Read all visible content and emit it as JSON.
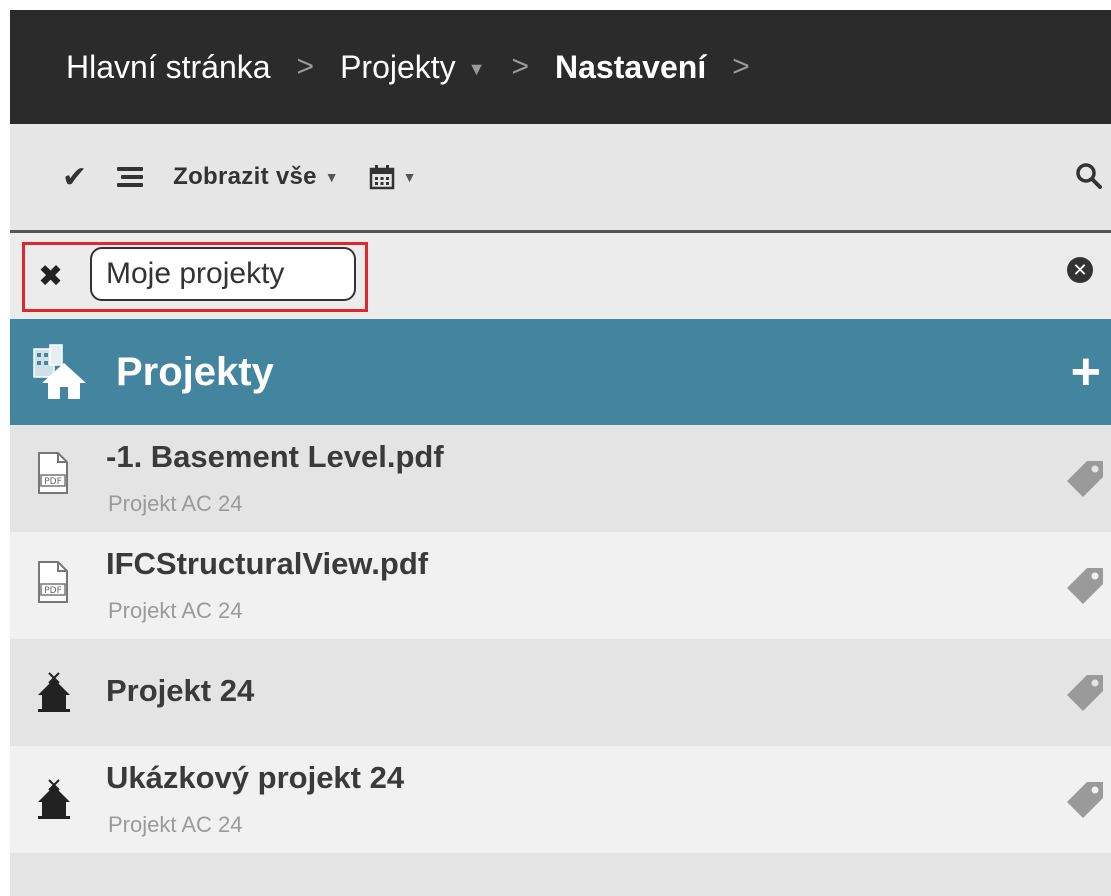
{
  "breadcrumb": {
    "items": [
      {
        "label": "Hlavní stránka"
      },
      {
        "label": "Projekty"
      },
      {
        "label": "Nastavení"
      }
    ],
    "separator": ">"
  },
  "toolbar": {
    "filter_label": "Zobrazit vše"
  },
  "filter": {
    "tag_label": "Moje projekty"
  },
  "section": {
    "title": "Projekty",
    "add_label": "+"
  },
  "rows": [
    {
      "title": "-1. Basement Level.pdf",
      "subtitle": "Projekt AC 24",
      "icon": "pdf-file-icon"
    },
    {
      "title": "IFCStructuralView.pdf",
      "subtitle": "Projekt AC 24",
      "icon": "pdf-file-icon"
    },
    {
      "title": "Projekt 24",
      "subtitle": "",
      "icon": "project-house-icon"
    },
    {
      "title": "Ukázkový projekt 24",
      "subtitle": "Projekt AC 24",
      "icon": "project-house-icon"
    }
  ],
  "colors": {
    "breadcrumb_bg": "#2b2b2b",
    "section_header_bg": "#43849f",
    "filter_highlight": "#e3262a"
  }
}
